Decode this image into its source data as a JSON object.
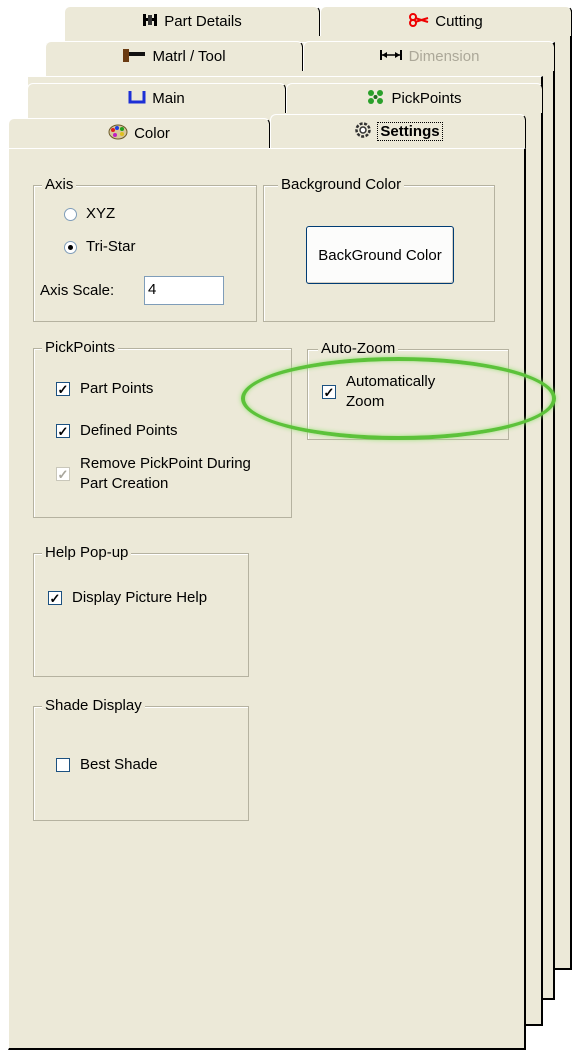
{
  "tabs": {
    "row4": [
      {
        "label": "Part Details",
        "icon": "part-details-icon"
      },
      {
        "label": "Cutting",
        "icon": "cutting-icon"
      }
    ],
    "row3": [
      {
        "label": "Matrl / Tool",
        "icon": "hammer-icon"
      },
      {
        "label": "Dimension",
        "icon": "dimension-icon"
      }
    ],
    "row2": [
      {
        "label": "Main",
        "icon": "main-icon"
      },
      {
        "label": "PickPoints",
        "icon": "pickpoints-icon"
      }
    ],
    "row1": [
      {
        "label": "Color",
        "icon": "palette-icon"
      },
      {
        "label": "Settings",
        "icon": "gear-icon"
      }
    ]
  },
  "axis": {
    "title": "Axis",
    "option_xyz": "XYZ",
    "option_tristar": "Tri-Star",
    "selected": "Tri-Star",
    "scale_label": "Axis Scale:",
    "scale_value": "4"
  },
  "background": {
    "title": "Background Color",
    "button_label": "BackGround Color"
  },
  "pickpoints": {
    "title": "PickPoints",
    "part_points": "Part Points",
    "defined_points": "Defined Points",
    "remove_pickpoint": "Remove PickPoint During Part Creation"
  },
  "autozoom": {
    "title": "Auto-Zoom",
    "automatically_zoom": "Automatically Zoom"
  },
  "help": {
    "title": "Help Pop-up",
    "display_picture_help": "Display Picture Help"
  },
  "shade": {
    "title": "Shade Display",
    "best_shade": "Best Shade"
  },
  "checkboxes": {
    "part_points": true,
    "defined_points": true,
    "remove_pickpoint": true,
    "automatically_zoom": true,
    "display_picture_help": true,
    "best_shade": false
  },
  "colors": {
    "panel": "#ece9d8",
    "highlight_ring": "#5cc23a"
  }
}
